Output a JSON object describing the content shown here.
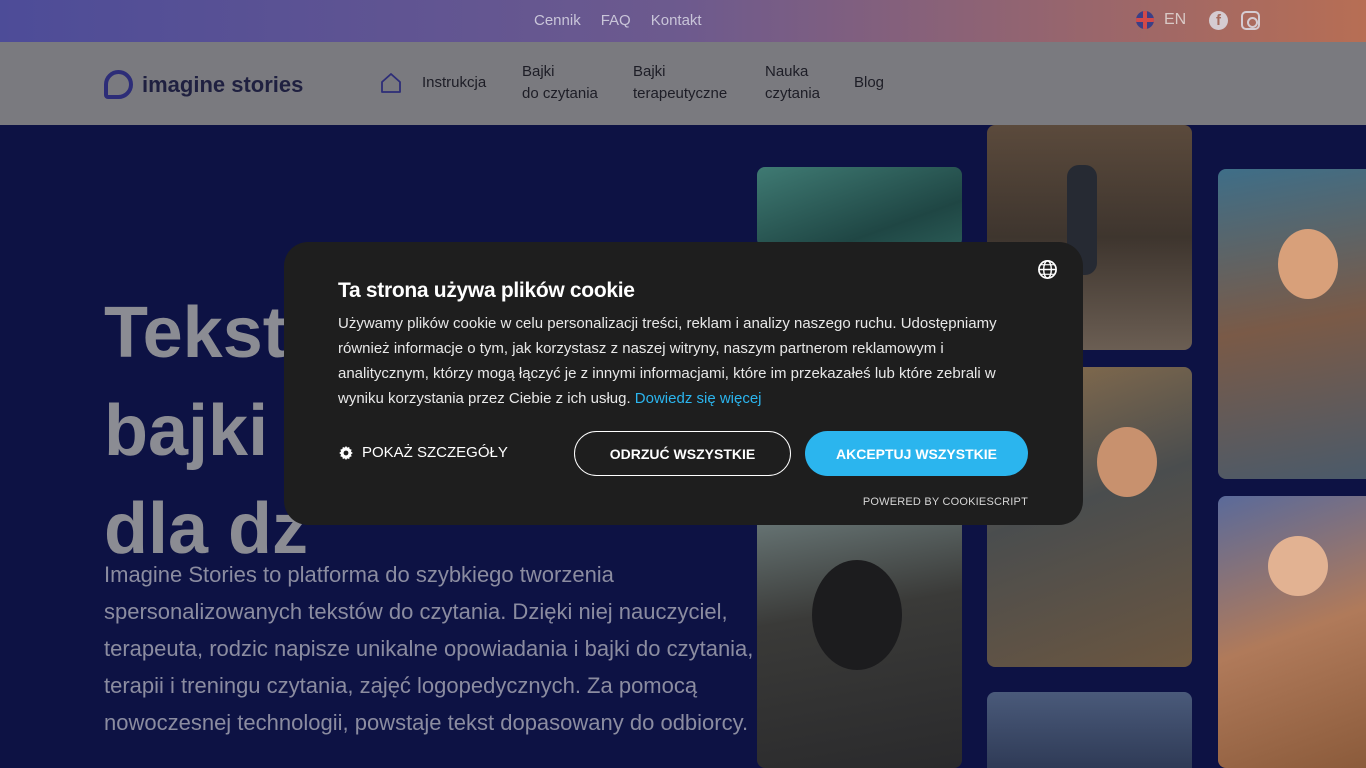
{
  "topbar": {
    "links": [
      "Cennik",
      "FAQ",
      "Kontakt"
    ],
    "language": "EN",
    "icons": [
      "uk-flag-icon",
      "facebook-icon",
      "instagram-icon"
    ]
  },
  "nav": {
    "logo_text": "imagine stories",
    "home_icon": "home-icon",
    "items": [
      {
        "line1": "Instrukcja",
        "line2": ""
      },
      {
        "line1": "Bajki",
        "line2": "do czytania"
      },
      {
        "line1": "Bajki",
        "line2": "terapeutyczne"
      },
      {
        "line1": "Nauka",
        "line2": "czytania"
      },
      {
        "line1": "Blog",
        "line2": ""
      }
    ]
  },
  "hero": {
    "title_lines": [
      "Teksty",
      "bajki i",
      "dla dz"
    ],
    "text": "Imagine Stories to platforma do szybkiego tworzenia spersonalizowanych tekstów do czytania. Dzięki niej nauczyciel, terapeuta, rodzic napisze unikalne opowiadania i bajki do czytania, terapii i treningu czytania, zajęć logopedycznych. Za pomocą nowoczesnej technologii, powstaje tekst dopasowany do odbiorcy."
  },
  "cookie": {
    "title": "Ta strona używa plików cookie",
    "description": "Używamy plików cookie w celu personalizacji treści, reklam i analizy naszego ruchu. Udostępniamy również informacje o tym, jak korzystasz z naszej witryny, naszym partnerom reklamowym i analitycznym, którzy mogą łączyć je z innymi informacjami, które im przekazałeś lub które zebrali w wyniku korzystania przez Ciebie z ich usług.",
    "learn_more": "Dowiedz się więcej",
    "details_label": "POKAŻ SZCZEGÓŁY",
    "reject_label": "ODRZUĆ WSZYSTKIE",
    "accept_label": "AKCEPTUJ WSZYSTKIE",
    "powered_by": "POWERED BY COOKIESCRIPT",
    "accent_color": "#2bb5ee"
  }
}
